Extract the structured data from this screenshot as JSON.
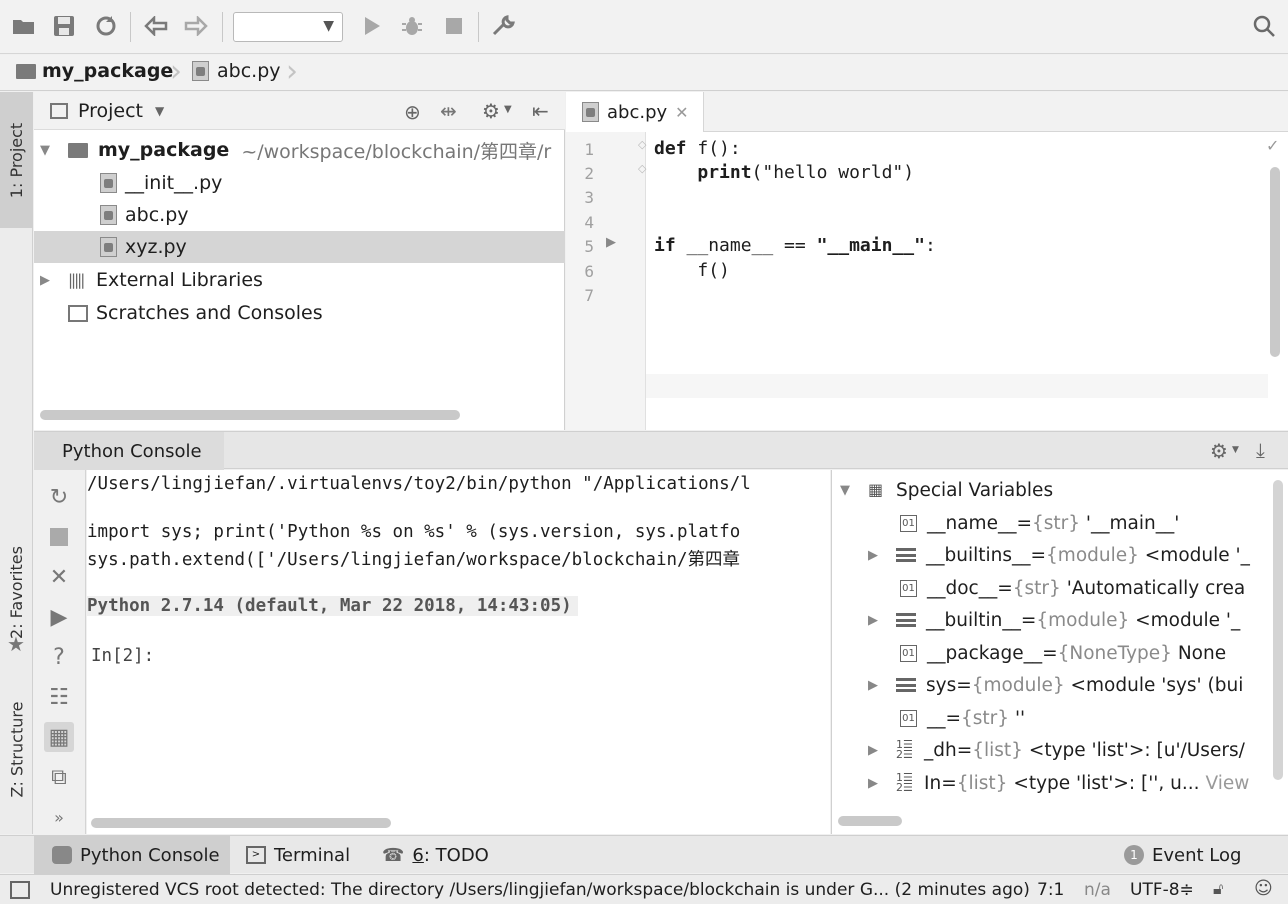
{
  "navbar": {
    "project": "my_package",
    "file": "abc.py"
  },
  "project_panel": {
    "title": "Project",
    "tree": [
      {
        "label": "my_package",
        "path": "~/workspace/blockchain/第四章/r"
      },
      {
        "label": "__init__.py"
      },
      {
        "label": "abc.py"
      },
      {
        "label": "xyz.py"
      },
      {
        "label": "External Libraries"
      },
      {
        "label": "Scratches and Consoles"
      }
    ]
  },
  "left_strip": {
    "project": "1: Project",
    "favorites": "2: Favorites",
    "structure": "Z: Structure"
  },
  "editor": {
    "tab": "abc.py",
    "line_numbers": [
      "1",
      "2",
      "3",
      "4",
      "5",
      "6",
      "7"
    ],
    "code": {
      "l1_kw": "def",
      "l1_rest": " f():",
      "l2_kw": "print",
      "l2_rest": "(\"hello world\")",
      "l5_kw": "if",
      "l5_mid": " __name__ == ",
      "l5_str": "\"__main__\"",
      "l5_end": ":",
      "l6": "f()"
    }
  },
  "console": {
    "tab": "Python Console",
    "lines": [
      "/Users/lingjiefan/.virtualenvs/toy2/bin/python \"/Applications/l",
      "import sys; print('Python %s on %s' % (sys.version, sys.platfo",
      "sys.path.extend(['/Users/lingjiefan/workspace/blockchain/第四章",
      "Python 2.7.14 (default, Mar 22 2018, 14:43:05)",
      "In[2]:"
    ]
  },
  "variables": {
    "header": "Special Variables",
    "rows": [
      {
        "name": "__name__",
        "type": "{str}",
        "value": "'__main__'"
      },
      {
        "name": "__builtins__",
        "type": "{module}",
        "value": "<module '_"
      },
      {
        "name": "__doc__",
        "type": "{str}",
        "value": "'Automatically crea"
      },
      {
        "name": "__builtin__",
        "type": "{module}",
        "value": "<module '_"
      },
      {
        "name": "__package__",
        "type": "{NoneType}",
        "value": "None"
      },
      {
        "name": "sys",
        "type": "{module}",
        "value": "<module 'sys' (bui"
      },
      {
        "name": "__",
        "type": "{str}",
        "value": "''"
      },
      {
        "name": "_dh",
        "type": "{list}",
        "value": "<type 'list'>: [u'/Users/"
      },
      {
        "name": "In",
        "type": "{list}",
        "value": "<type 'list'>: ['', u...",
        "link": "View"
      }
    ],
    "sep": " = "
  },
  "bottom_tabs": {
    "python_console": "Python Console",
    "terminal": "Terminal",
    "todo_num": "6",
    "todo": ": TODO",
    "event_log": "Event Log",
    "event_count": "1"
  },
  "status": {
    "message": "Unregistered VCS root detected: The directory /Users/lingjiefan/workspace/blockchain is under G... (2 minutes ago)",
    "position": "7:1",
    "na": "n/a",
    "encoding": "UTF-8≑"
  }
}
